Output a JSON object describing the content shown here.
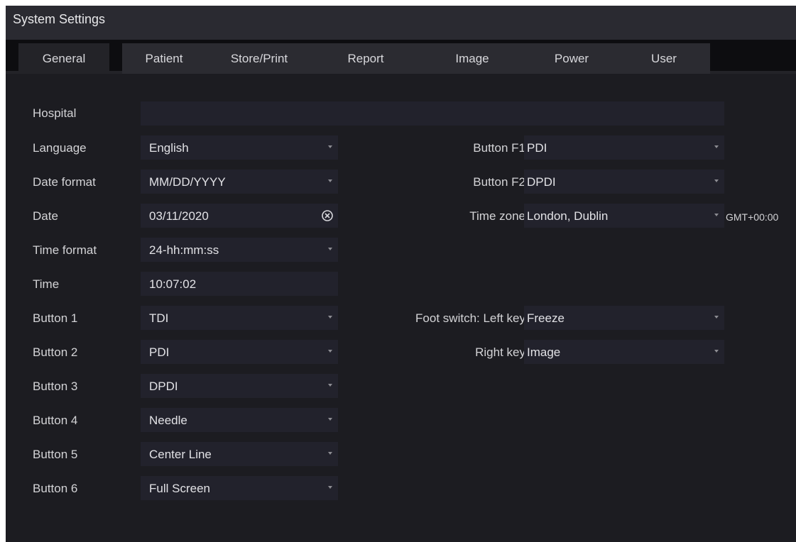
{
  "window": {
    "title": "System Settings"
  },
  "tabs": [
    "General",
    "Patient",
    "Store/Print",
    "Report",
    "Image",
    "Power",
    "User"
  ],
  "active_tab": "General",
  "general": {
    "hospital": {
      "label": "Hospital",
      "value": ""
    },
    "language": {
      "label": "Language",
      "value": "English"
    },
    "date_format": {
      "label": "Date format",
      "value": "MM/DD/YYYY"
    },
    "date": {
      "label": "Date",
      "value": "03/11/2020"
    },
    "time_format": {
      "label": "Time format",
      "value": "24-hh:mm:ss"
    },
    "time": {
      "label": "Time",
      "value": "10:07:02"
    },
    "buttons": [
      {
        "label": "Button 1",
        "value": "TDI"
      },
      {
        "label": "Button 2",
        "value": "PDI"
      },
      {
        "label": "Button 3",
        "value": "DPDI"
      },
      {
        "label": "Button 4",
        "value": "Needle"
      },
      {
        "label": "Button 5",
        "value": "Center Line"
      },
      {
        "label": "Button 6",
        "value": "Full Screen"
      }
    ],
    "button_f1": {
      "label": "Button F1",
      "value": "PDI"
    },
    "button_f2": {
      "label": "Button F2",
      "value": "DPDI"
    },
    "time_zone": {
      "label": "Time zone",
      "value": "London, Dublin",
      "offset": "GMT+00:00"
    },
    "foot_switch_left": {
      "label": "Foot switch: Left key",
      "value": "Freeze"
    },
    "foot_switch_right": {
      "label": "Right key",
      "value": "Image"
    }
  },
  "icons": {
    "dropdown": "chevron-down-icon",
    "clear": "clear-circle-icon"
  },
  "colors": {
    "background": "#1c1c21",
    "field": "#22222c",
    "text": "#d3d3d6"
  }
}
